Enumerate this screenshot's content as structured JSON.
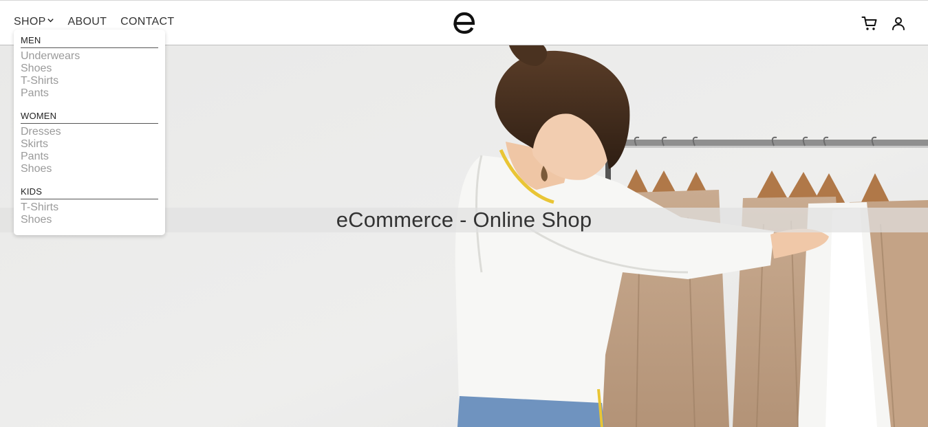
{
  "nav": {
    "shop_label": "SHOP",
    "about_label": "ABOUT",
    "contact_label": "CONTACT"
  },
  "logo": {
    "letter": "e"
  },
  "header_icons": [
    "cart-icon",
    "user-icon"
  ],
  "hero": {
    "title": "eCommerce - Online Shop"
  },
  "dropdown": {
    "sections": [
      {
        "heading": "MEN",
        "items": [
          "Underwears",
          "Shoes",
          "T-Shirts",
          "Pants"
        ]
      },
      {
        "heading": "WOMEN",
        "items": [
          "Dresses",
          "Skirts",
          "Pants",
          "Shoes"
        ]
      },
      {
        "heading": "KIDS",
        "items": [
          "T-Shirts",
          "Shoes"
        ]
      }
    ]
  },
  "colors": {
    "text": "#333333",
    "menu_item": "#9a9a9a",
    "hero_bg": "#ececeb",
    "header_border": "#bdbdbd"
  }
}
